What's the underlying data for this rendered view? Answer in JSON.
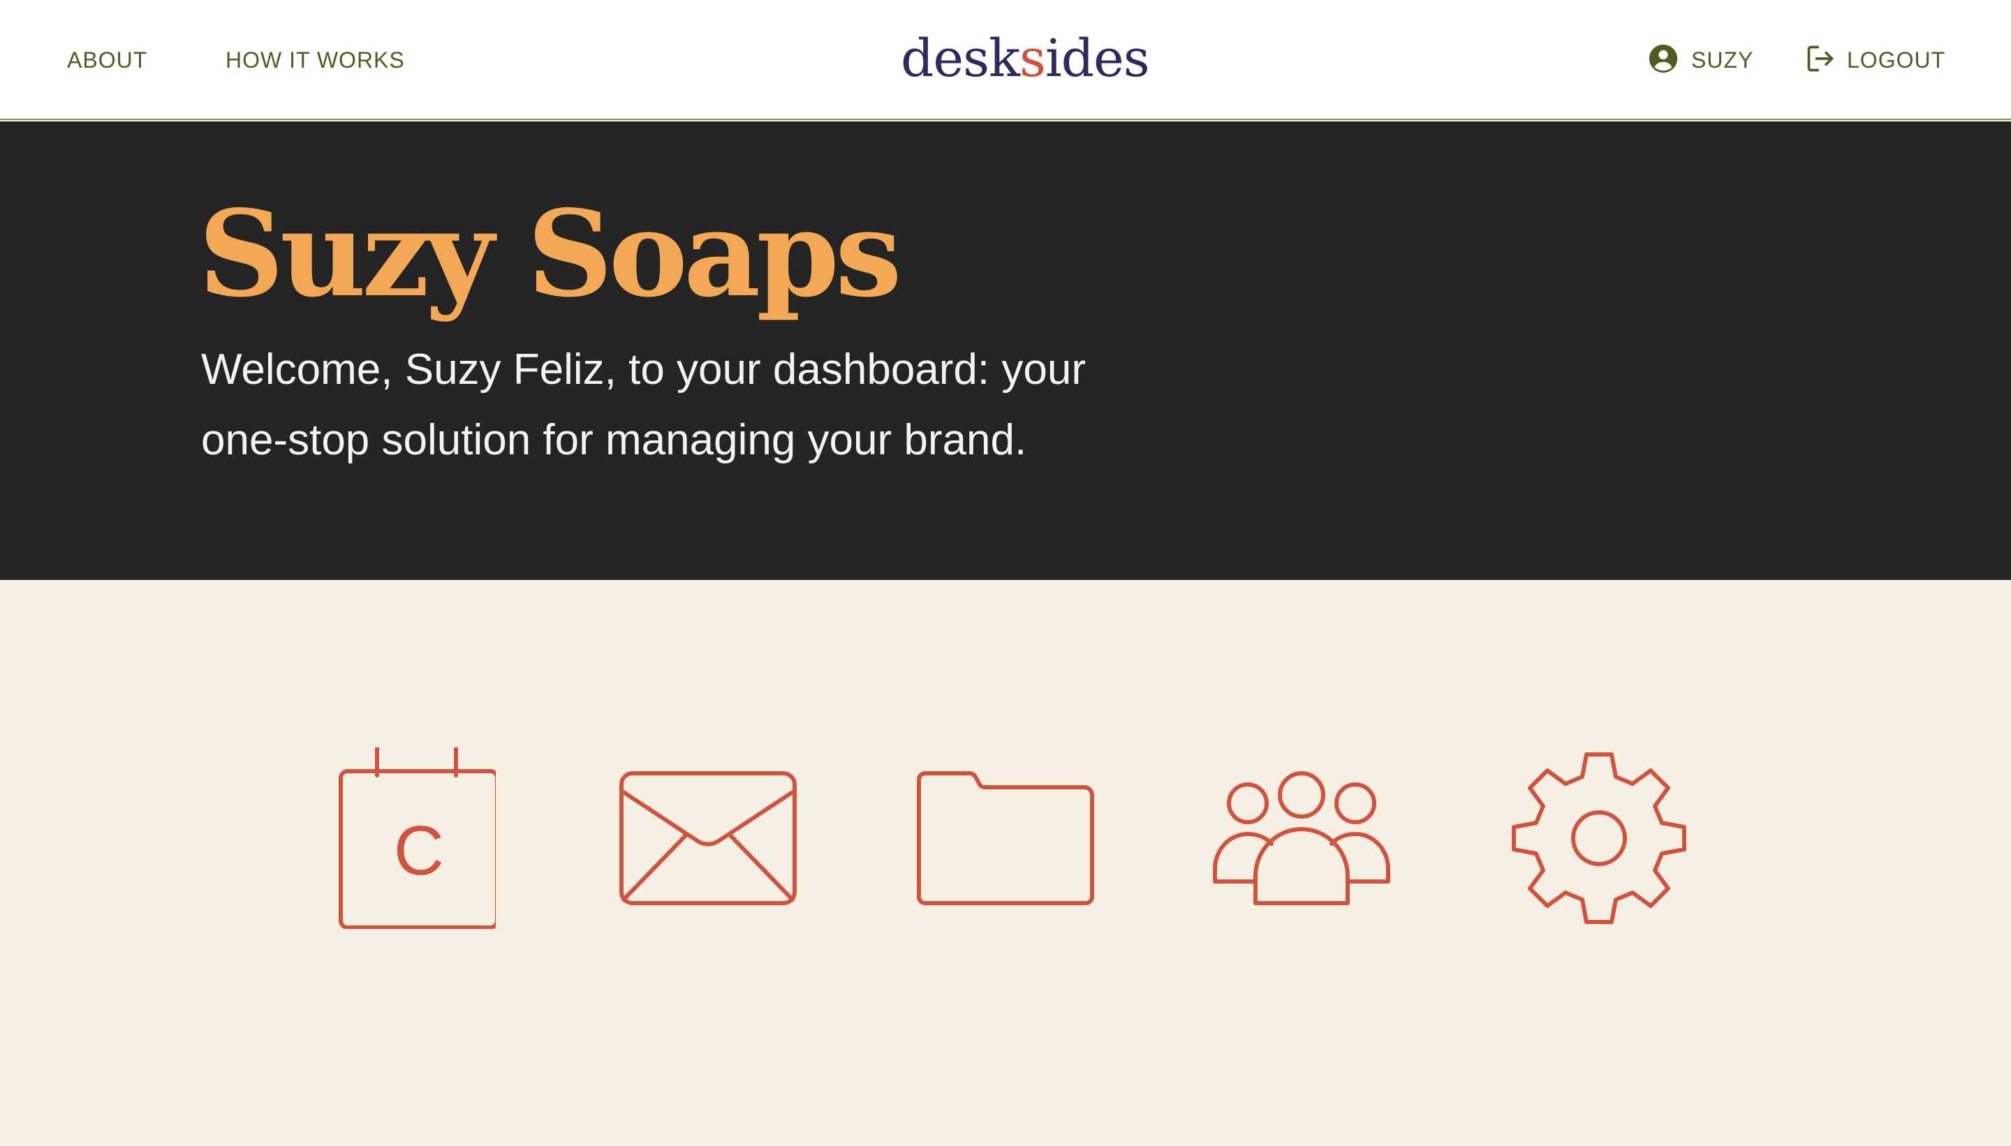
{
  "nav": {
    "about_label": "ABOUT",
    "how_label": "HOW IT WORKS",
    "logo_prefix": "desk",
    "logo_s": "s",
    "logo_suffix": "ides",
    "user_label": "SUZY",
    "user_icon": "account-circle-icon",
    "logout_label": "LOGOUT",
    "logout_icon": "logout-icon"
  },
  "hero": {
    "brand_name": "Suzy Soaps",
    "welcome_line1": "Welcome, Suzy Feliz, to your dashboard: your",
    "welcome_line2": "one-stop solution for managing your brand."
  },
  "tools": [
    {
      "icon": "calendar-icon",
      "letter": "C"
    },
    {
      "icon": "mail-icon"
    },
    {
      "icon": "folder-icon"
    },
    {
      "icon": "team-icon"
    },
    {
      "icon": "gear-icon"
    }
  ],
  "colors": {
    "nav_text": "#4d5e22",
    "logo": "#2d2a5f",
    "accent": "#d34f3b",
    "brand_title": "#f2a854",
    "hero_bg": "#242424",
    "page_bg": "#f5f0e3",
    "icon_stroke": "#d0533f"
  }
}
